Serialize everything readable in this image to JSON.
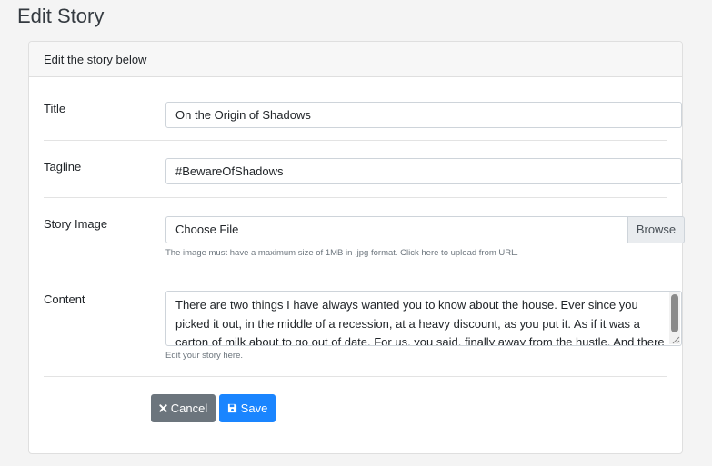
{
  "page": {
    "title": "Edit Story"
  },
  "card": {
    "header": "Edit the story below"
  },
  "form": {
    "title": {
      "label": "Title",
      "value": "On the Origin of Shadows"
    },
    "tagline": {
      "label": "Tagline",
      "value": "#BewareOfShadows"
    },
    "story_image": {
      "label": "Story Image",
      "file_label": "Choose File",
      "browse_label": "Browse",
      "help": "The image must have a maximum size of 1MB in .jpg format. Click here to upload from URL."
    },
    "content": {
      "label": "Content",
      "value": "There are two things I have always wanted you to know about the house. Ever since you picked it out, in the middle of a recession, at a heavy discount, as you put it. As if it was a carton of milk about to go out of date. For us, you said, finally away from the hustle. And there are two",
      "help": "Edit your story here."
    }
  },
  "actions": {
    "cancel_label": "Cancel",
    "save_label": "Save"
  },
  "icons": {
    "cancel": "times-icon",
    "save": "floppy-disk-icon"
  },
  "colors": {
    "cancel_button": "#6c757d",
    "save_button": "#1a85ff"
  }
}
